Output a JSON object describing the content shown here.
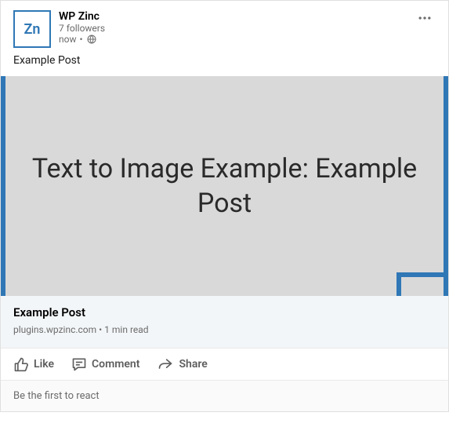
{
  "header": {
    "avatar_text": "Zn",
    "author": "WP Zinc",
    "followers": "7 followers",
    "time": "now",
    "separator": "•"
  },
  "post": {
    "text": "Example Post"
  },
  "image": {
    "caption": "Text to Image Example: Example Post"
  },
  "link": {
    "title": "Example Post",
    "meta": "plugins.wpzinc.com • 1 min read"
  },
  "actions": {
    "like": "Like",
    "comment": "Comment",
    "share": "Share"
  },
  "reactions": {
    "prompt": "Be the first to react"
  }
}
